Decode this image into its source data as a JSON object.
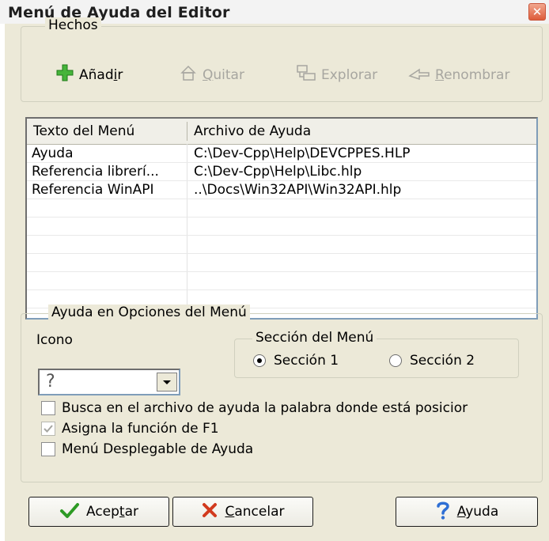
{
  "window": {
    "title": "Menú de Ayuda del Editor",
    "close_glyph": "✕"
  },
  "toolbar_group": {
    "legend": "Hechos",
    "buttons": [
      {
        "pre": "Añad",
        "ul": "i",
        "post": "r",
        "icon": "plus-icon",
        "enabled": true
      },
      {
        "pre": "",
        "ul": "Q",
        "post": "uitar",
        "icon": "remove-icon",
        "enabled": false
      },
      {
        "pre": "Explorar",
        "ul": "",
        "post": "",
        "icon": "explore-icon",
        "enabled": false
      },
      {
        "pre": "",
        "ul": "R",
        "post": "enombrar",
        "icon": "rename-icon",
        "enabled": false
      }
    ]
  },
  "list": {
    "columns": [
      "Texto del Menú",
      "Archivo de Ayuda"
    ],
    "rows": [
      {
        "text": "Ayuda",
        "file": "C:\\Dev-Cpp\\Help\\DEVCPPES.HLP"
      },
      {
        "text": "Referencia librerí...",
        "file": "C:\\Dev-Cpp\\Help\\Libc.hlp"
      },
      {
        "text": "Referencia WinAPI",
        "file": "..\\Docs\\Win32API\\Win32API.hlp"
      }
    ]
  },
  "options_group": {
    "legend": "Ayuda en Opciones del Menú",
    "icon_label": "Icono",
    "icon_value": "?",
    "section_legend": "Sección del Menú",
    "radios": [
      {
        "label": "Sección 1",
        "selected": true
      },
      {
        "label": "Sección 2",
        "selected": false
      }
    ],
    "checkboxes": [
      {
        "label": "Busca en el archivo de ayuda la palabra donde está posicior",
        "checked": false,
        "disabled": false
      },
      {
        "label": "Asigna la función de F1",
        "checked": true,
        "disabled": true
      },
      {
        "label": "Menú Desplegable de Ayuda",
        "checked": false,
        "disabled": false
      }
    ]
  },
  "buttons": {
    "ok": {
      "pre": "Acep",
      "ul": "t",
      "post": "ar"
    },
    "cancel": {
      "pre": "",
      "ul": "C",
      "post": "ancelar"
    },
    "help": {
      "pre": "",
      "ul": "A",
      "post": "yuda"
    }
  },
  "colors": {
    "face": "#ece9d8",
    "accent_green": "#2d9a24",
    "cancel_red": "#d23a1e",
    "help_blue": "#2e6fd4"
  }
}
